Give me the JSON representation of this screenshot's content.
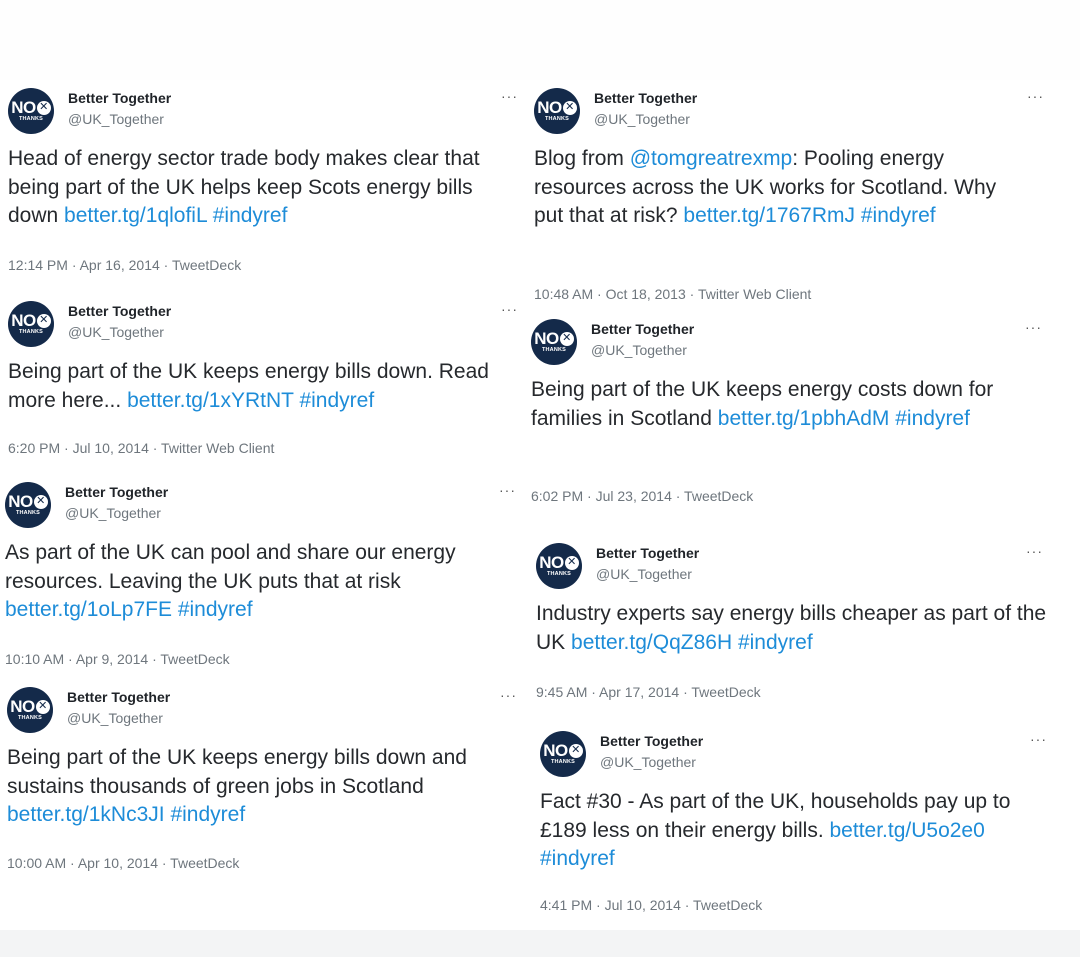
{
  "tweets": [
    {
      "author": "Better Together",
      "handle": "@UK_Together",
      "text_before": "Head of energy sector trade body makes clear that being part of the UK helps keep Scots energy bills down ",
      "link1": "better.tg/1qlofiL",
      "hashtag": "#indyref",
      "meta": "12:14 PM · Apr 16, 2014 · TweetDeck"
    },
    {
      "author": "Better Together",
      "handle": "@UK_Together",
      "text_before": "Being part of the UK keeps energy bills down. Read more here... ",
      "link1": "better.tg/1xYRtNT",
      "hashtag": "#indyref",
      "meta": "6:20 PM · Jul 10, 2014 · Twitter Web Client"
    },
    {
      "author": "Better Together",
      "handle": "@UK_Together",
      "text_before": "As part of the UK can pool and share our energy resources. Leaving the UK puts that at risk ",
      "link1": "better.tg/1oLp7FE",
      "hashtag": "#indyref",
      "meta": "10:10 AM · Apr 9, 2014 · TweetDeck"
    },
    {
      "author": "Better Together",
      "handle": "@UK_Together",
      "text_before": "Being part of the UK keeps energy bills down and sustains thousands of green jobs in Scotland ",
      "link1": "better.tg/1kNc3JI",
      "hashtag": "#indyref",
      "meta": "10:00 AM · Apr 10, 2014 · TweetDeck"
    },
    {
      "author": "Better Together",
      "handle": "@UK_Together",
      "text_before": "Blog from ",
      "mention": "@tomgreatrexmp",
      "text_mid": ": Pooling energy resources across the UK works for Scotland. Why put that at risk? ",
      "link1": "better.tg/1767RmJ",
      "hashtag": "#indyref",
      "meta": "10:48 AM · Oct 18, 2013 · Twitter Web Client"
    },
    {
      "author": "Better Together",
      "handle": "@UK_Together",
      "text_before": "Being part of the UK keeps energy costs down for families in Scotland ",
      "link1": "better.tg/1pbhAdM",
      "hashtag": "#indyref",
      "meta": "6:02 PM · Jul 23, 2014 · TweetDeck"
    },
    {
      "author": "Better Together",
      "handle": "@UK_Together",
      "text_before": "Industry experts say energy bills cheaper as part of the UK ",
      "link1": "better.tg/QqZ86H",
      "hashtag": "#indyref",
      "meta": "9:45 AM · Apr 17, 2014 · TweetDeck"
    },
    {
      "author": "Better Together",
      "handle": "@UK_Together",
      "text_before": "Fact #30 - As part of the UK, households pay up to £189 less on their energy bills. ",
      "link1": "better.tg/U5o2e0",
      "hashtag": "#indyref",
      "meta": "4:41 PM · Jul 10, 2014 · TweetDeck"
    }
  ],
  "avatar": {
    "logo_text": "NO",
    "logo_mark": "✕",
    "logo_sub": "THANKS"
  },
  "more_label": "···",
  "colors": {
    "link": "#1d8cd8",
    "avatar": "#142a4a",
    "meta": "#6e767d"
  }
}
